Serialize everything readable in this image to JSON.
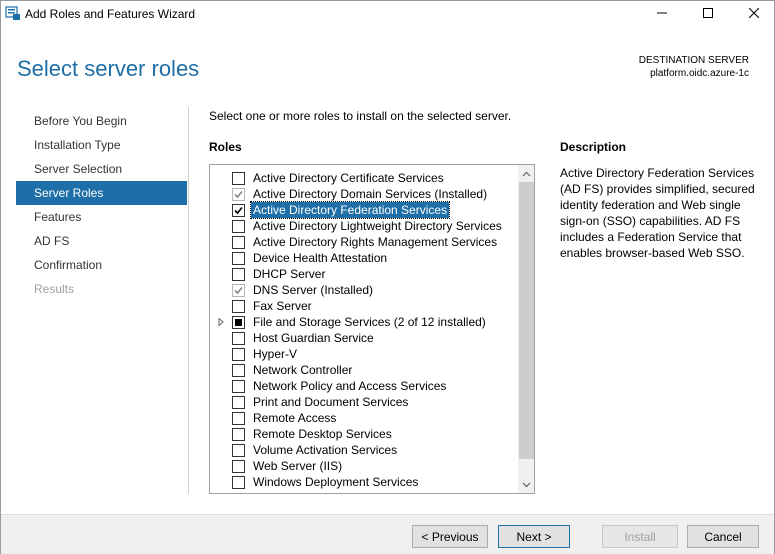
{
  "window": {
    "title": "Add Roles and Features Wizard",
    "accent": "#1e6ea7"
  },
  "header": {
    "page_title": "Select server roles",
    "destination_label": "DESTINATION SERVER",
    "destination_value": "platform.oidc.azure-1c"
  },
  "nav": {
    "items": [
      {
        "label": "Before You Begin",
        "state": "normal"
      },
      {
        "label": "Installation Type",
        "state": "normal"
      },
      {
        "label": "Server Selection",
        "state": "normal"
      },
      {
        "label": "Server Roles",
        "state": "active"
      },
      {
        "label": "Features",
        "state": "normal"
      },
      {
        "label": "AD FS",
        "state": "normal"
      },
      {
        "label": "Confirmation",
        "state": "normal"
      },
      {
        "label": "Results",
        "state": "disabled"
      }
    ]
  },
  "main": {
    "instruction": "Select one or more roles to install on the selected server.",
    "roles_heading": "Roles",
    "roles": [
      {
        "label": "Active Directory Certificate Services",
        "check": "unchecked"
      },
      {
        "label": "Active Directory Domain Services (Installed)",
        "check": "checked-disabled"
      },
      {
        "label": "Active Directory Federation Services",
        "check": "checked",
        "selected": true
      },
      {
        "label": "Active Directory Lightweight Directory Services",
        "check": "unchecked"
      },
      {
        "label": "Active Directory Rights Management Services",
        "check": "unchecked"
      },
      {
        "label": "Device Health Attestation",
        "check": "unchecked"
      },
      {
        "label": "DHCP Server",
        "check": "unchecked"
      },
      {
        "label": "DNS Server (Installed)",
        "check": "checked-disabled"
      },
      {
        "label": "Fax Server",
        "check": "unchecked"
      },
      {
        "label": "File and Storage Services (2 of 12 installed)",
        "check": "partial",
        "expandable": true
      },
      {
        "label": "Host Guardian Service",
        "check": "unchecked"
      },
      {
        "label": "Hyper-V",
        "check": "unchecked"
      },
      {
        "label": "Network Controller",
        "check": "unchecked"
      },
      {
        "label": "Network Policy and Access Services",
        "check": "unchecked"
      },
      {
        "label": "Print and Document Services",
        "check": "unchecked"
      },
      {
        "label": "Remote Access",
        "check": "unchecked"
      },
      {
        "label": "Remote Desktop Services",
        "check": "unchecked"
      },
      {
        "label": "Volume Activation Services",
        "check": "unchecked"
      },
      {
        "label": "Web Server (IIS)",
        "check": "unchecked"
      },
      {
        "label": "Windows Deployment Services",
        "check": "unchecked"
      }
    ]
  },
  "description": {
    "heading": "Description",
    "text": "Active Directory Federation Services (AD FS) provides simplified, secured identity federation and Web single sign-on (SSO) capabilities. AD FS includes a Federation Service that enables browser-based Web SSO."
  },
  "footer": {
    "previous_label": "< Previous",
    "next_label": "Next >",
    "install_label": "Install",
    "cancel_label": "Cancel"
  }
}
